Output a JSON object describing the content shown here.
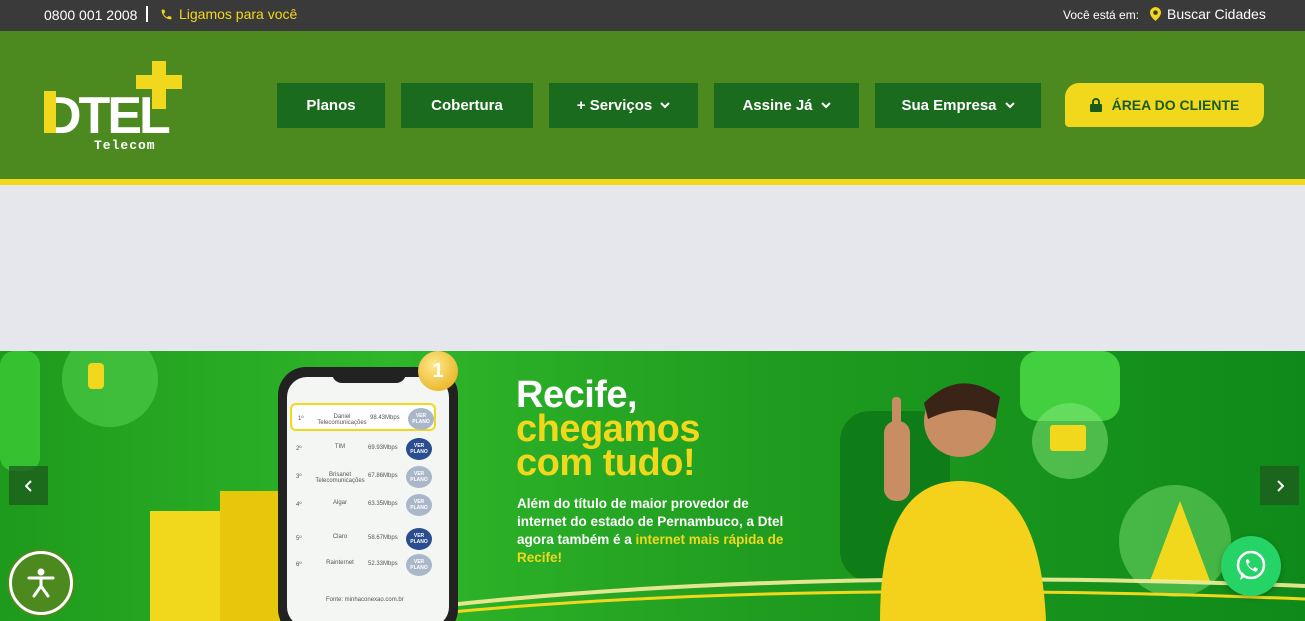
{
  "topbar": {
    "phone": "0800 001 2008",
    "callback_label": "Ligamos para você",
    "location_label": "Você está em:",
    "location_link": "Buscar Cidades"
  },
  "header": {
    "logo_main": "DTEL",
    "logo_sub": "Telecom",
    "nav": [
      {
        "label": "Planos"
      },
      {
        "label": "Cobertura"
      },
      {
        "label": "+ Serviços"
      },
      {
        "label": "Assine Já"
      },
      {
        "label": "Sua Empresa"
      }
    ],
    "cliente_label": "ÁREA DO CLIENTE"
  },
  "banner": {
    "headline_line1": "Recife,",
    "headline_line2": "chegamos",
    "headline_line3": "com tudo!",
    "sub_part1": "Além do título de maior provedor de internet do estado de Pernambuco, a Dtel agora também é a ",
    "sub_highlight": "internet mais rápida de Recife!",
    "medal": "1",
    "ranking": [
      {
        "pos": "1º",
        "name": "Daniel Telecomunicações",
        "speed": "98.43Mbps",
        "button": "VER PLANO"
      },
      {
        "pos": "2º",
        "name": "TIM",
        "speed": "69.93Mbps",
        "button": "VER PLANO"
      },
      {
        "pos": "3º",
        "name": "Brisanet Telecomunicações",
        "speed": "67.86Mbps",
        "button": "VER PLANO"
      },
      {
        "pos": "4º",
        "name": "Algar",
        "speed": "63.35Mbps",
        "button": "VER PLANO"
      },
      {
        "pos": "5º",
        "name": "Claro",
        "speed": "58.67Mbps",
        "button": "VER PLANO"
      },
      {
        "pos": "6º",
        "name": "Rainternet",
        "speed": "52.33Mbps",
        "button": "VER PLANO"
      }
    ],
    "fonte": "Fonte: minhaconexao.com.br"
  },
  "colors": {
    "topbar": "#3a3a3a",
    "header_green": "#4c8a1f",
    "nav_green": "#1a6b1e",
    "accent_yellow": "#f2d81c",
    "grey_band": "#e6e7ec",
    "whatsapp": "#25d366"
  },
  "icons": [
    "phone-icon",
    "map-pin-icon",
    "chevron-down-icon",
    "lock-icon",
    "chevron-left-icon",
    "chevron-right-icon",
    "accessibility-icon",
    "whatsapp-icon"
  ]
}
